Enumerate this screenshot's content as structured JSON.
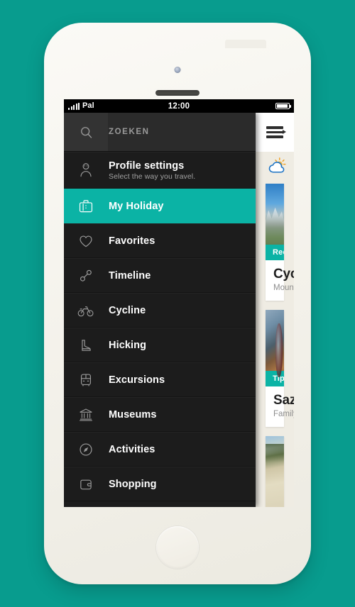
{
  "status_bar": {
    "carrier": "Pal",
    "time": "12:00",
    "signal_icon": "signal-bars-icon",
    "battery_icon": "battery-icon"
  },
  "drawer": {
    "search": {
      "icon": "search-icon",
      "placeholder": "ZOEKEN"
    },
    "items": [
      {
        "icon": "person-icon",
        "label": "Profile settings",
        "sub": "Select the way you travel.",
        "active": false
      },
      {
        "icon": "suitcase-icon",
        "label": "My Holiday",
        "sub": "",
        "active": true
      },
      {
        "icon": "heart-icon",
        "label": "Favorites",
        "sub": "",
        "active": false
      },
      {
        "icon": "timeline-icon",
        "label": "Timeline",
        "sub": "",
        "active": false
      },
      {
        "icon": "bicycle-icon",
        "label": "Cycline",
        "sub": "",
        "active": false
      },
      {
        "icon": "boot-icon",
        "label": "Hicking",
        "sub": "",
        "active": false
      },
      {
        "icon": "bus-icon",
        "label": "Excursions",
        "sub": "",
        "active": false
      },
      {
        "icon": "museum-icon",
        "label": "Museums",
        "sub": "",
        "active": false
      },
      {
        "icon": "compass-icon",
        "label": "Activities",
        "sub": "",
        "active": false
      },
      {
        "icon": "wallet-icon",
        "label": "Shopping",
        "sub": "",
        "active": false
      }
    ]
  },
  "content": {
    "menu_toggle_icon": "hamburger-menu-icon",
    "weather_icon": "sun-behind-cloud-icon",
    "cards": [
      {
        "photo": "mountain-photo",
        "badge": "Recommended",
        "title": "Cycling",
        "sub": "Mountain route",
        "photo_class": "photo-mountain"
      },
      {
        "photo": "dinner-photo",
        "badge": "Tips of the day",
        "title": "Sazerac",
        "sub": "Family restaurant",
        "photo_class": "photo-dinner"
      },
      {
        "photo": "beach-photo",
        "badge": "",
        "title": "",
        "sub": "",
        "photo_class": "photo-beach"
      }
    ]
  },
  "colors": {
    "page_background": "#089c8e",
    "accent_teal": "#0bb3a5",
    "drawer_dark": "#1c1c1c",
    "content_cream": "#efece3"
  }
}
